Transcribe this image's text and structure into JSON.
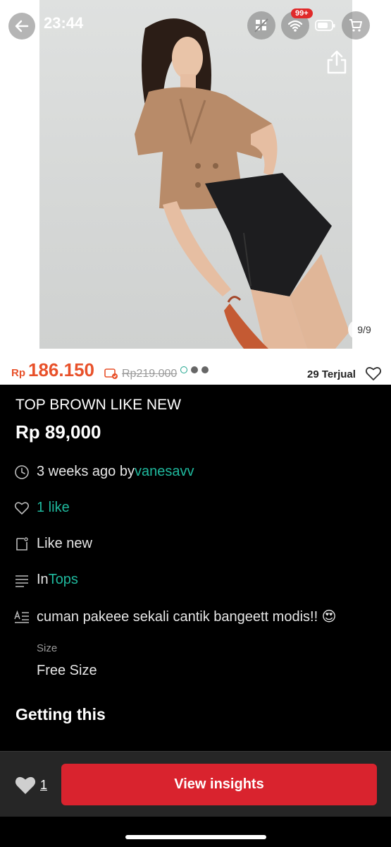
{
  "status_bar": {
    "time": "23:44",
    "cart_badge": "99+"
  },
  "gallery": {
    "counter": "9/9",
    "dots_total": 3,
    "active_dot": 0
  },
  "price_strip": {
    "currency": "Rp",
    "price": "186.150",
    "old_price": "Rp219.000",
    "sold": "29 Terjual",
    "accent_color": "#e8512a"
  },
  "listing": {
    "title": "TOP BROWN LIKE NEW",
    "price": "Rp 89,000",
    "time_text": "3 weeks ago by ",
    "seller": "vanesavv",
    "likes": "1 like",
    "condition": "Like new",
    "category_prefix": "In ",
    "category": "Tops",
    "description": "cuman pakeee sekali cantik bangeett modis!! 😍",
    "size_label": "Size",
    "size_value": "Free Size",
    "section_title": "Getting this",
    "link_color": "#1fb89d"
  },
  "bottom_bar": {
    "like_count": "1",
    "cta_label": "View insights",
    "cta_color": "#d9232e"
  },
  "icons": [
    "back-arrow-icon",
    "share-icon",
    "more-vertical-icon",
    "heart-outline-icon",
    "clock-icon",
    "tag-icon",
    "list-icon",
    "description-icon",
    "heart-filled-icon",
    "cart-icon",
    "wifi-icon",
    "battery-icon"
  ]
}
